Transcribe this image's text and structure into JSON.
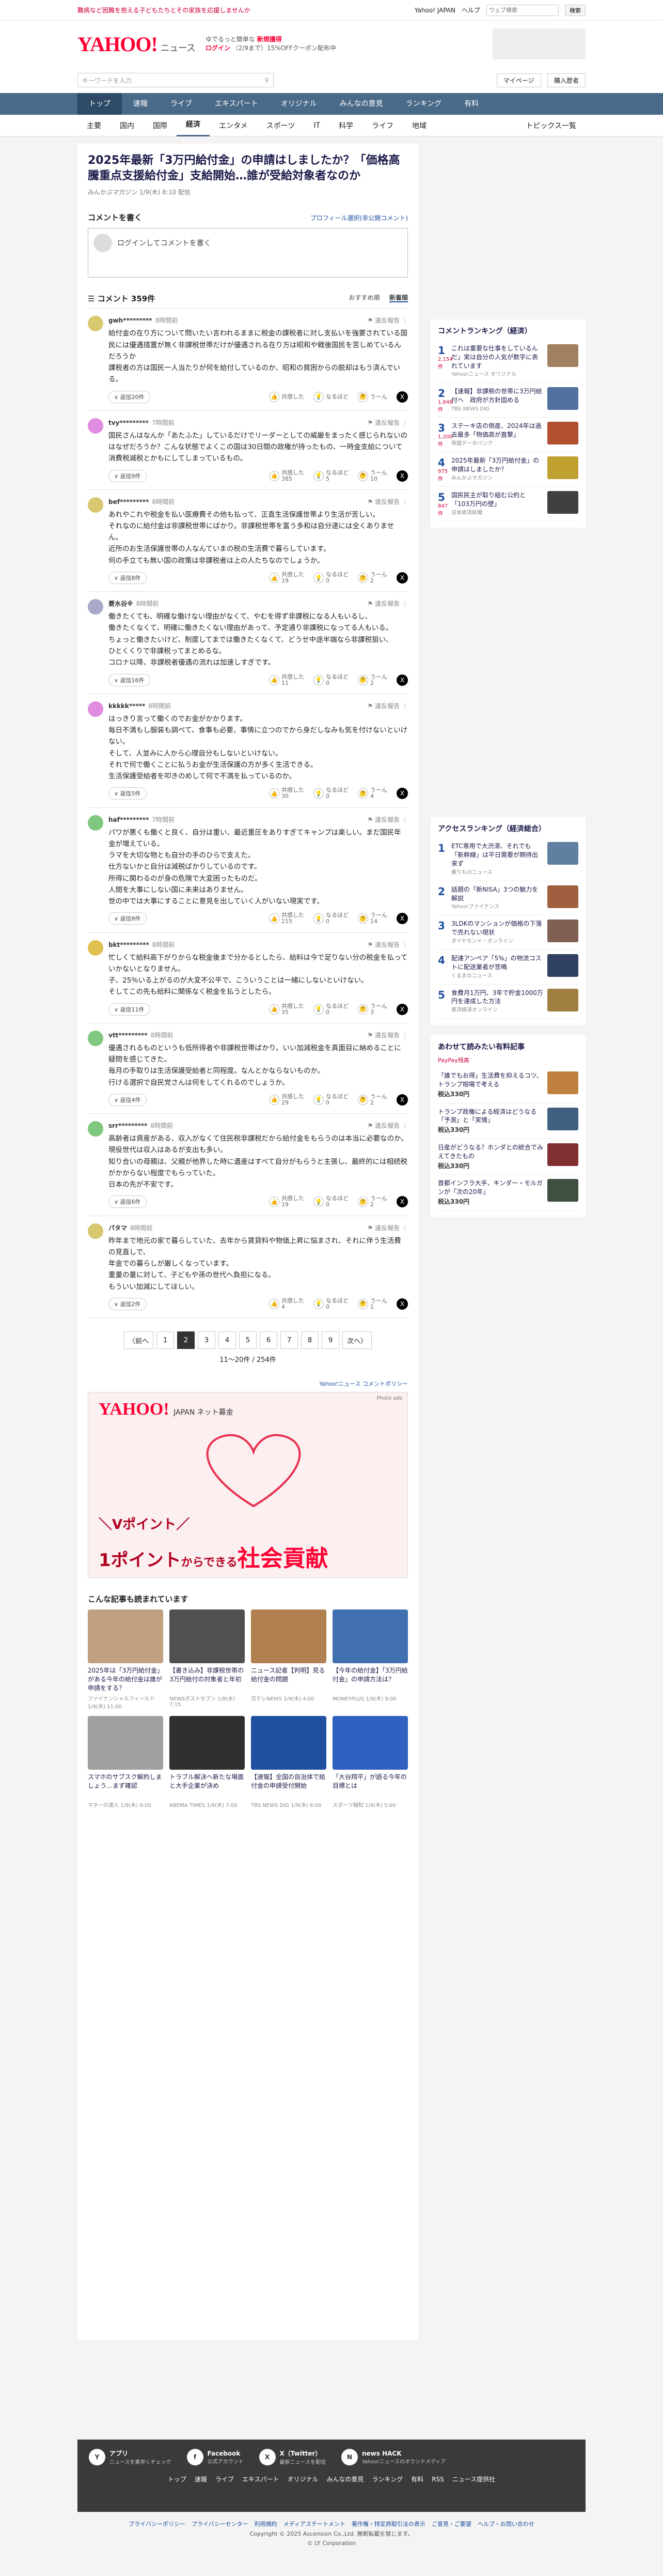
{
  "topbar": {
    "promo": "難病など困難を抱える子どもたちとその家族を応援しませんか",
    "links": [
      "Yahoo! JAPAN",
      "ヘルプ"
    ],
    "search_placeholder": "ウェブ検索",
    "search_button": "検索"
  },
  "header": {
    "logo": "YAHOO!",
    "logo_sub": "ニュース",
    "pr_line1": "ゆでるっと簡単な",
    "pr_highlight": "新規獲得",
    "pr_line2": "ログイン",
    "pr_line3": "（2/9まで）15%OFFクーポン配布中",
    "mypage": "マイページ",
    "buy": "購入歴者"
  },
  "search": {
    "placeholder": "キーワードを入力",
    "icon": "search-icon"
  },
  "nav": {
    "items": [
      "トップ",
      "速報",
      "ライブ",
      "エキスパート",
      "オリジナル",
      "みんなの意見",
      "ランキング",
      "有料"
    ],
    "active": 0
  },
  "subnav": {
    "items": [
      "主要",
      "国内",
      "国際",
      "経済",
      "エンタメ",
      "スポーツ",
      "IT",
      "科学",
      "ライフ",
      "地域"
    ],
    "active": 3,
    "right": "トピックス一覧"
  },
  "article": {
    "title": "2025年最新「3万円給付金」の申請はしましたか？「価格高騰重点支援給付金」支給開始…誰が受給対象者なのか",
    "meta": "みんかぶマガジン 1/9(木) 8:10 配信"
  },
  "compose": {
    "heading": "コメントを書く",
    "profile_link": "プロフィール選択(非公開コメント)",
    "placeholder": "ログインしてコメントを書く"
  },
  "comments_header": {
    "title": "コメント",
    "count": "359件",
    "sort": [
      "おすすめ順",
      "新着順"
    ]
  },
  "labels": {
    "reply": "返信",
    "report": "違反報告",
    "like": "共感した",
    "hmm": "なるほど",
    "think": "うーん"
  },
  "comments": [
    {
      "user": "gwh*********",
      "time": "8時間前",
      "color": "#d8c870",
      "text": "給付金の在り方について問いたい言われるままに税金の課税者に対し支払いを強要されている国民には優遇措置が無く非課税世帯だけが優遇される在り方は昭和や戦後国民を苦しめているんだろうか\n課税者の方は国民一人当たりが何を給付しているのか、昭和の貧困からの脱却はもう済んでいる。",
      "replies": "返信20件",
      "like": "",
      "hmm": "",
      "think": ""
    },
    {
      "user": "tvy*********",
      "time": "7時間前",
      "color": "#e08ce0",
      "text": "国民さんはなんか「あたふた」しているだけでリーダーとしての威厳をまったく感じられないのはなぜだろうか？こんな状態でよくこの国は30日間の政権が持ったもの、一時金支給について消費税減税とかもにしてしまっているもの。",
      "replies": "返信9件",
      "like": "385",
      "hmm": "5",
      "think": "10"
    },
    {
      "user": "bef*********",
      "time": "8時間前",
      "color": "#d8c870",
      "text": "あれやこれや税金を払い医療費その他も払って、正直生活保護世帯より生活が苦しい。\nそれなのに給付金は非課税世帯にばかり。非課税世帯を富う多和は自分達には全くありません。\n近所のお生活保護世帯の人なんていまの税の生活費で暮らしています。\n何の手立ても無い国の政策は非課税者は上の人たちなのでしょうか。",
      "replies": "返信8件",
      "like": "19",
      "hmm": "0",
      "think": "2"
    },
    {
      "user": "菱水谷※",
      "time": "8時間前",
      "color": "#a8a8c8",
      "text": "働きたくても、明確な働けない理由がなくて、やむを得ず非課税になる人もいるし、\n働きたくなくて、明確に働きたくない理由があって、予定通り非課税になってる人もいる。\nちょっと働きたいけど、制度してまでは働きたくなくて、どうせ中途半端なら非課税狙い、\nひとくくりで非課税ってまとめるな。\nコロナ以降、非課税者優遇の流れは加速しすぎです。",
      "replies": "返信16件",
      "like": "11",
      "hmm": "0",
      "think": "2"
    },
    {
      "user": "kkkkk*****",
      "time": "8時間前",
      "color": "#e08ce0",
      "text": "はっきり言って働くのでお金がかかります。\n毎日不満もし服装も調べて、食事も必要、事情に立つのでから身だしなみも気を付けないといけない。\nそして、人並みに人から心理自分もしないといけない。\nそれで何で働くことに払うお金が生活保護の方が多く生活できる。\n生活保護受給者を叩きのめして何で不満を払っているのか。",
      "replies": "返信5件",
      "like": "30",
      "hmm": "0",
      "think": "4"
    },
    {
      "user": "haf*********",
      "time": "7時間前",
      "color": "#80c880",
      "text": "パワが悪くも働くと良く、自分は重い、最近重圧をありすぎてキャンプは楽しい。まだ国民年金が増えている。\nラマを大切な物とも自分の手のひらで支えた。\n仕方ないかと自分は減税ばかりしているのです。\n所得に関わるのが身の危険で大変困ったものだ。\n人間を大事にしない国に未来はありません。\n世の中では大事にすることに意見を出していく人がいない現実です。",
      "replies": "返信8件",
      "like": "215",
      "hmm": "0",
      "think": "14"
    },
    {
      "user": "bkt*********",
      "time": "8時間前",
      "color": "#e0c050",
      "text": "忙しくて給料高下がりからな税金後まで分かるとしたら、給料は今で足りない分の税金を払っていかないとなりません。\n子、25％いる上がるのが大変不公平で、こういうことは一緒にしないといけない。\nそしてこの先も給料に関係なく税金を払うとしたら。",
      "replies": "返信11件",
      "like": "35",
      "hmm": "0",
      "think": "3"
    },
    {
      "user": "vtt*********",
      "time": "8時間前",
      "color": "#80c880",
      "text": "優遇されるものというも低所得者や非課税世帯ばかり。いい加減税金を真面目に納めることに疑問を感じてきた。\n毎月の手取りは生活保護受給者と同程度。なんとかならないものか。\n行ける選択で自民党さんは何をしてくれるのでしょうか。",
      "replies": "返信4件",
      "like": "29",
      "hmm": "0",
      "think": "2"
    },
    {
      "user": "srr*********",
      "time": "8時間前",
      "color": "#80c880",
      "text": "高齢者は資産がある、収入がなくて住民税非課税だから給付金をもらうのは本当に必要なのか。\n現役世代は収入はあるが支出も多い。\n知り合いの母親は、父親が他界した時に遺産はすべて自分がもらうと主張し、最終的には相続税がかからない程度でもらっていた。\n日本の先が不安です。",
      "replies": "返信6件",
      "like": "19",
      "hmm": "0",
      "think": "2"
    },
    {
      "user": "パタマ",
      "time": "8時間前",
      "color": "#d8c870",
      "text": "昨年まで地元の家で暮らしていた、去年から賃貸料や物価上昇に悩まされ、それに伴う生活費の見直しで、\n年金での暮らしが厳しくなっています。\n重量の量に対して、子どもや孫の世代へ負担になる。\nもういい加減にしてほしい。",
      "replies": "返信2件",
      "like": "4",
      "hmm": "0",
      "think": "1"
    }
  ],
  "pager": {
    "prev": "〈前へ",
    "pages": [
      "1",
      "2",
      "3",
      "4",
      "5",
      "6",
      "7",
      "8",
      "9"
    ],
    "current": 1,
    "next": "次へ〉",
    "info": "11～20件 / 254件"
  },
  "ad": {
    "link": "Yahoo!ニュース コメントポリシー",
    "photo_credit": "Photo ads",
    "brand": "YAHOO!",
    "brand_sub": "JAPAN ネット募金",
    "line1": "＼Vポイント／",
    "line2_pre": "1ポイント",
    "line2_mid": "からできる",
    "line2_em": "社会貢献"
  },
  "related": {
    "heading": "こんな記事も読まれています",
    "items": [
      {
        "title": "2025年は「3万円給付金」がある今年の給付金は誰が申請をする？",
        "src": "ファイナンシャルフィールド",
        "time": "1/9(木) 11:00",
        "color": "#c0a080"
      },
      {
        "title": "【書き込み】非課税世帯の3万円給付の対象者と年初",
        "src": "NEWSポストセブン",
        "time": "1/8(水) 7:15",
        "color": "#505050"
      },
      {
        "title": "ニュース記者【判明】見る給付金の問題",
        "src": "日テレNEWS",
        "time": "1/9(木) 4:00",
        "color": "#b08050"
      },
      {
        "title": "【今年の給付金】「3万円給付金」の申請方法は？",
        "src": "MONEYPLUS",
        "time": "1/9(木) 9:00",
        "color": "#4070b0"
      },
      {
        "title": "スマホのサブスク解約しましょう…まず確認",
        "src": "マネーの達人",
        "time": "1/9(木) 8:00",
        "color": "#a0a0a0"
      },
      {
        "title": "トラブル解決へ新たな場面と大手企業が決め",
        "src": "ABEMA TIMES",
        "time": "1/9(木) 7:00",
        "color": "#303030"
      },
      {
        "title": "【速報】全国の自治体で給付金の申請受付開始",
        "src": "TBS NEWS DIG",
        "time": "1/9(木) 6:00",
        "color": "#2050a0"
      },
      {
        "title": "「大谷翔平」が語る今年の目標とは",
        "src": "スポーツ報知",
        "time": "1/9(木) 5:00",
        "color": "#3060c0"
      }
    ]
  },
  "side_comment_ranking": {
    "heading": "コメントランキング（経済）",
    "items": [
      {
        "n": "1",
        "cnt": "2,154件",
        "title": "これは重要な仕事をしているんだ」実は自分の人気が数字に表れています",
        "src": "Yahoo!ニュース オリジナル",
        "color": "#a08060"
      },
      {
        "n": "2",
        "cnt": "1,848件",
        "title": "【速報】非課税の世帯に3万円給付へ　政府が方針固める",
        "src": "TBS NEWS DIG",
        "color": "#5070a0"
      },
      {
        "n": "3",
        "cnt": "1,200件",
        "title": "ステーキ店の倒産、2024年は過去最多「物価高が直撃」",
        "src": "帝国データバンク",
        "color": "#b05030"
      },
      {
        "n": "4",
        "cnt": "975件",
        "title": "2025年最新「3万円給付金」の申請はしましたか？",
        "src": "みんかぶマガジン",
        "color": "#c0a030"
      },
      {
        "n": "5",
        "cnt": "847件",
        "title": "国民民主が取り組む公約と「103万円の壁」",
        "src": "日本経済新聞",
        "color": "#404040"
      }
    ]
  },
  "side_access_ranking": {
    "heading": "アクセスランキング（経済総合）",
    "items": [
      {
        "n": "1",
        "cnt": "",
        "title": "ETC専用で大渋滞、それでも「新幹線」は平日需要が期待出来ず",
        "src": "乗りものニュース",
        "color": "#6080a0"
      },
      {
        "n": "2",
        "cnt": "",
        "title": "話題の「新NISA」3つの魅力を解説",
        "src": "Yahoo!ファイナンス",
        "color": "#a06040"
      },
      {
        "n": "3",
        "cnt": "",
        "title": "3LDKのマンションが価格の下落で売れない現状",
        "src": "ダイヤモンド・オンライン",
        "color": "#806050"
      },
      {
        "n": "4",
        "cnt": "",
        "title": "配達アンペア「5%」の物流コストに配送業者が悲鳴",
        "src": "くるまのニュース",
        "color": "#304060"
      },
      {
        "n": "5",
        "cnt": "",
        "title": "食費月1万円、3年で貯金1000万円を達成した方法",
        "src": "東洋経済オンライン",
        "color": "#a08040"
      }
    ]
  },
  "side_pay": {
    "heading": "あわせて読みたい有料記事",
    "badge": "PayPay残高",
    "items": [
      {
        "title": "「誰でもお得」生活費を抑えるコツ、トランプ相場で考える",
        "price": "税込330円",
        "color": "#c08040"
      },
      {
        "title": "トランプ政権による経済はどうなる「予測」と「実情」",
        "price": "税込330円",
        "color": "#406080"
      },
      {
        "title": "日産がどうなる？ホンダとの統合でみえてきたもの",
        "price": "税込330円",
        "color": "#803030"
      },
      {
        "title": "首都インフラ大手、キンダー・モルガンが「次の20年」",
        "price": "税込330円",
        "color": "#405040"
      }
    ]
  },
  "footer": {
    "cols": [
      {
        "icon": "app-icon",
        "glyph": "Y",
        "title": "アプリ",
        "sub": "ニュースを素早くチェック"
      },
      {
        "icon": "facebook-icon",
        "glyph": "f",
        "title": "Facebook",
        "sub": "公式アカウント"
      },
      {
        "icon": "x-icon",
        "glyph": "X",
        "title": "X（Twitter）",
        "sub": "最新ニュースを配信"
      },
      {
        "icon": "news-hack-icon",
        "glyph": "N",
        "title": "news HACK",
        "sub": "Yahoo!ニュースのオウンドメディア"
      }
    ],
    "nav": [
      "トップ",
      "速報",
      "ライブ",
      "エキスパート",
      "オリジナル",
      "みんなの意見",
      "ランキング",
      "有料",
      "RSS",
      "ニュース提供社"
    ]
  },
  "legal": {
    "links": [
      "プライバシーポリシー",
      "プライバシーセンター",
      "利用規約",
      "メディアステートメント",
      "著作権・特定商取引法の表示",
      "ご意見・ご要望",
      "ヘルプ・お問い合わせ"
    ],
    "copy1": "Copyright © 2025 Ascension Co.,Ltd. 無断転載を禁じます。",
    "copy2": "© LY Corporation"
  }
}
